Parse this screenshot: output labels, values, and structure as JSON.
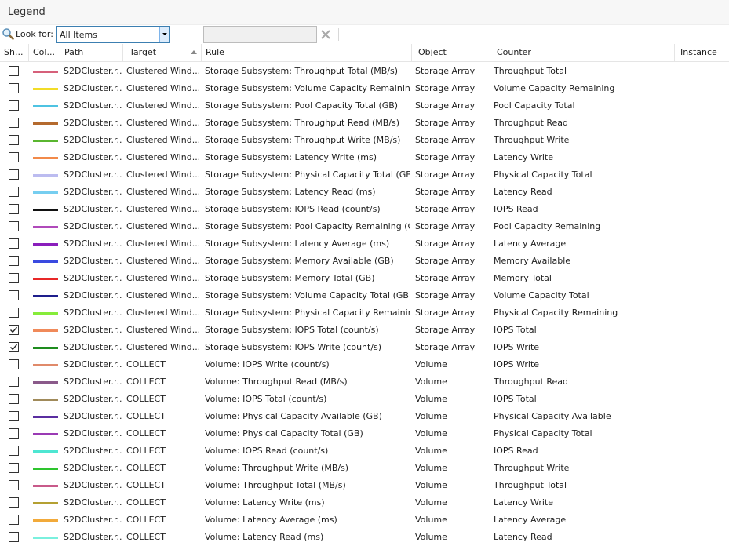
{
  "legend": {
    "title": "Legend"
  },
  "toolbar": {
    "look_for_label": "Look for:",
    "filter_value": "All Items",
    "search_value": ""
  },
  "columns": [
    "Sh...",
    "Col...",
    "Path",
    "Target",
    "Rule",
    "Object",
    "Counter",
    "Instance"
  ],
  "rows": [
    {
      "checked": false,
      "color": "#d6607a",
      "path": "S2DCluster.r...",
      "target": "Clustered Wind...",
      "rule": "Storage Subsystem: Throughput Total (MB/s)",
      "object": "Storage Array",
      "counter": "Throughput Total",
      "instance": ""
    },
    {
      "checked": false,
      "color": "#f2dc28",
      "path": "S2DCluster.r...",
      "target": "Clustered Wind...",
      "rule": "Storage Subsystem: Volume Capacity Remaining (...",
      "object": "Storage Array",
      "counter": "Volume Capacity Remaining",
      "instance": ""
    },
    {
      "checked": false,
      "color": "#4ec3e2",
      "path": "S2DCluster.r...",
      "target": "Clustered Wind...",
      "rule": "Storage Subsystem: Pool Capacity Total (GB)",
      "object": "Storage Array",
      "counter": "Pool Capacity Total",
      "instance": ""
    },
    {
      "checked": false,
      "color": "#b46a2e",
      "path": "S2DCluster.r...",
      "target": "Clustered Wind...",
      "rule": "Storage Subsystem: Throughput Read (MB/s)",
      "object": "Storage Array",
      "counter": "Throughput Read",
      "instance": ""
    },
    {
      "checked": false,
      "color": "#5ab630",
      "path": "S2DCluster.r...",
      "target": "Clustered Wind...",
      "rule": "Storage Subsystem: Throughput Write (MB/s)",
      "object": "Storage Array",
      "counter": "Throughput Write",
      "instance": ""
    },
    {
      "checked": false,
      "color": "#f28a4a",
      "path": "S2DCluster.r...",
      "target": "Clustered Wind...",
      "rule": "Storage Subsystem: Latency Write (ms)",
      "object": "Storage Array",
      "counter": "Latency Write",
      "instance": ""
    },
    {
      "checked": false,
      "color": "#bcbcf0",
      "path": "S2DCluster.r...",
      "target": "Clustered Wind...",
      "rule": "Storage Subsystem: Physical Capacity Total (GB)",
      "object": "Storage Array",
      "counter": "Physical Capacity Total",
      "instance": ""
    },
    {
      "checked": false,
      "color": "#76cef0",
      "path": "S2DCluster.r...",
      "target": "Clustered Wind...",
      "rule": "Storage Subsystem: Latency Read (ms)",
      "object": "Storage Array",
      "counter": "Latency Read",
      "instance": ""
    },
    {
      "checked": false,
      "color": "#111111",
      "path": "S2DCluster.r...",
      "target": "Clustered Wind...",
      "rule": "Storage Subsystem: IOPS Read (count/s)",
      "object": "Storage Array",
      "counter": "IOPS Read",
      "instance": ""
    },
    {
      "checked": false,
      "color": "#b04aba",
      "path": "S2DCluster.r...",
      "target": "Clustered Wind...",
      "rule": "Storage Subsystem: Pool Capacity Remaining (GB)",
      "object": "Storage Array",
      "counter": "Pool Capacity Remaining",
      "instance": ""
    },
    {
      "checked": false,
      "color": "#8a1ebc",
      "path": "S2DCluster.r...",
      "target": "Clustered Wind...",
      "rule": "Storage Subsystem: Latency Average (ms)",
      "object": "Storage Array",
      "counter": "Latency Average",
      "instance": ""
    },
    {
      "checked": false,
      "color": "#3a4ae0",
      "path": "S2DCluster.r...",
      "target": "Clustered Wind...",
      "rule": "Storage Subsystem: Memory Available (GB)",
      "object": "Storage Array",
      "counter": "Memory Available",
      "instance": ""
    },
    {
      "checked": false,
      "color": "#e82828",
      "path": "S2DCluster.r...",
      "target": "Clustered Wind...",
      "rule": "Storage Subsystem: Memory Total (GB)",
      "object": "Storage Array",
      "counter": "Memory Total",
      "instance": ""
    },
    {
      "checked": false,
      "color": "#1e1e8c",
      "path": "S2DCluster.r...",
      "target": "Clustered Wind...",
      "rule": "Storage Subsystem: Volume Capacity Total (GB)",
      "object": "Storage Array",
      "counter": "Volume Capacity Total",
      "instance": ""
    },
    {
      "checked": false,
      "color": "#86ec3a",
      "path": "S2DCluster.r...",
      "target": "Clustered Wind...",
      "rule": "Storage Subsystem: Physical Capacity Remaining ...",
      "object": "Storage Array",
      "counter": "Physical Capacity Remaining",
      "instance": ""
    },
    {
      "checked": true,
      "color": "#f08a5a",
      "path": "S2DCluster.r...",
      "target": "Clustered Wind...",
      "rule": "Storage Subsystem: IOPS Total (count/s)",
      "object": "Storage Array",
      "counter": "IOPS Total",
      "instance": ""
    },
    {
      "checked": true,
      "color": "#1e8c1e",
      "path": "S2DCluster.r...",
      "target": "Clustered Wind...",
      "rule": "Storage Subsystem: IOPS Write (count/s)",
      "object": "Storage Array",
      "counter": "IOPS Write",
      "instance": ""
    },
    {
      "checked": false,
      "color": "#e08a6a",
      "path": "S2DCluster.r...",
      "target": "COLLECT",
      "rule": "Volume: IOPS Write (count/s)",
      "object": "Volume",
      "counter": "IOPS Write",
      "instance": ""
    },
    {
      "checked": false,
      "color": "#8a5a8a",
      "path": "S2DCluster.r...",
      "target": "COLLECT",
      "rule": "Volume: Throughput Read (MB/s)",
      "object": "Volume",
      "counter": "Throughput Read",
      "instance": ""
    },
    {
      "checked": false,
      "color": "#a08a5a",
      "path": "S2DCluster.r...",
      "target": "COLLECT",
      "rule": "Volume: IOPS Total (count/s)",
      "object": "Volume",
      "counter": "IOPS Total",
      "instance": ""
    },
    {
      "checked": false,
      "color": "#5a2ea0",
      "path": "S2DCluster.r...",
      "target": "COLLECT",
      "rule": "Volume: Physical Capacity Available (GB)",
      "object": "Volume",
      "counter": "Physical Capacity Available",
      "instance": ""
    },
    {
      "checked": false,
      "color": "#9a3ab4",
      "path": "S2DCluster.r...",
      "target": "COLLECT",
      "rule": "Volume: Physical Capacity Total (GB)",
      "object": "Volume",
      "counter": "Physical Capacity Total",
      "instance": ""
    },
    {
      "checked": false,
      "color": "#4ee6d2",
      "path": "S2DCluster.r...",
      "target": "COLLECT",
      "rule": "Volume: IOPS Read (count/s)",
      "object": "Volume",
      "counter": "IOPS Read",
      "instance": ""
    },
    {
      "checked": false,
      "color": "#2ec42e",
      "path": "S2DCluster.r...",
      "target": "COLLECT",
      "rule": "Volume: Throughput Write (MB/s)",
      "object": "Volume",
      "counter": "Throughput Write",
      "instance": ""
    },
    {
      "checked": false,
      "color": "#c85a8a",
      "path": "S2DCluster.r...",
      "target": "COLLECT",
      "rule": "Volume: Throughput Total (MB/s)",
      "object": "Volume",
      "counter": "Throughput Total",
      "instance": ""
    },
    {
      "checked": false,
      "color": "#b4a032",
      "path": "S2DCluster.r...",
      "target": "COLLECT",
      "rule": "Volume: Latency Write (ms)",
      "object": "Volume",
      "counter": "Latency Write",
      "instance": ""
    },
    {
      "checked": false,
      "color": "#f2aa3a",
      "path": "S2DCluster.r...",
      "target": "COLLECT",
      "rule": "Volume: Latency Average (ms)",
      "object": "Volume",
      "counter": "Latency Average",
      "instance": ""
    },
    {
      "checked": false,
      "color": "#7af0de",
      "path": "S2DCluster.r...",
      "target": "COLLECT",
      "rule": "Volume: Latency Read (ms)",
      "object": "Volume",
      "counter": "Latency Read",
      "instance": ""
    }
  ]
}
